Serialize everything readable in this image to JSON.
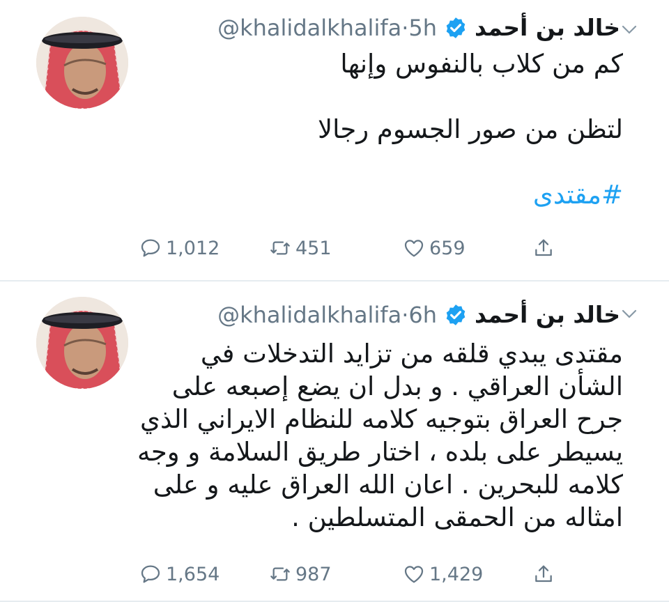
{
  "tweets": [
    {
      "author_name": "خالد بن أحمد",
      "handle": "@khalidalkhalifa",
      "time": "5h",
      "separator": "·",
      "text_lines": [
        "كم من كلاب بالنفوس وإنها",
        "",
        "لتظن من صور الجسوم رجالا",
        ""
      ],
      "hashtag": "#مقتدى",
      "replies": "1,012",
      "retweets": "451",
      "likes": "659"
    },
    {
      "author_name": "خالد بن أحمد",
      "handle": "@khalidalkhalifa",
      "time": "6h",
      "separator": "·",
      "text": "مقتدى يبدي قلقه من تزايد التدخلات في الشأن العراقي . و بدل ان يضع إصبعه على جرح العراق بتوجيه كلامه للنظام الايراني الذي يسيطر على بلده ، اختار طريق السلامة و وجه كلامه للبحرين . اعان الله العراق عليه و على امثاله من الحمقى المتسلطين .",
      "replies": "1,654",
      "retweets": "987",
      "likes": "1,429"
    }
  ],
  "icons": {
    "verified": "verified-badge-icon",
    "caret": "chevron-down-icon",
    "reply": "reply-icon",
    "retweet": "retweet-icon",
    "like": "heart-icon",
    "share": "share-icon"
  },
  "colors": {
    "text": "#14171a",
    "secondary": "#657786",
    "accent": "#1da1f2",
    "divider": "#e6ecf0"
  }
}
